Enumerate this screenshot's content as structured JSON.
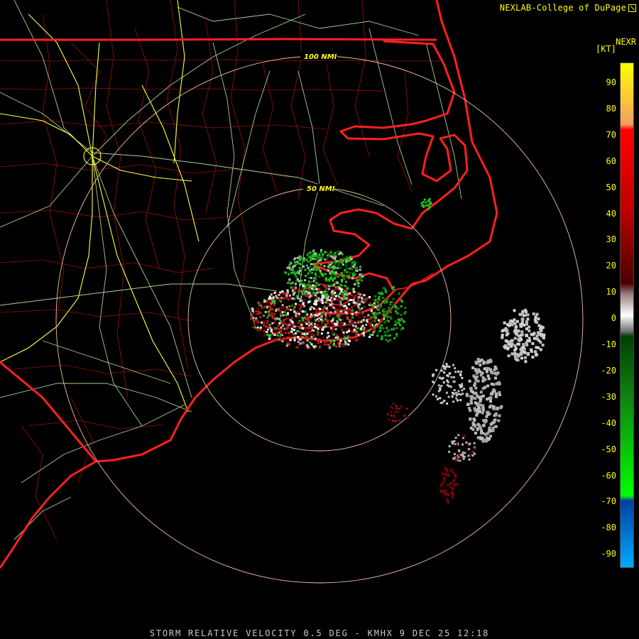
{
  "credit": "NEXLAB-College of DuPage",
  "product_title": "STORM RELATIVE VELOCITY 0.5 DEG - KMHX 9 DEC 25 12:18",
  "scale": {
    "title": "NEXR",
    "unit": "[KT]",
    "ticks": [
      "90",
      "80",
      "70",
      "60",
      "50",
      "40",
      "30",
      "20",
      "10",
      "0",
      "-10",
      "-20",
      "-30",
      "-40",
      "-50",
      "-60",
      "-70",
      "-80",
      "-90"
    ],
    "gradient": [
      {
        "value": 95,
        "color": "#ffff00"
      },
      {
        "value": 72,
        "color": "#f4a060"
      },
      {
        "value": 70,
        "color": "#ff0000"
      },
      {
        "value": 40,
        "color": "#c00000"
      },
      {
        "value": 12,
        "color": "#4a0000"
      },
      {
        "value": 8,
        "color": "#9a8080"
      },
      {
        "value": 0,
        "color": "#ffffff"
      },
      {
        "value": -6,
        "color": "#707070"
      },
      {
        "value": -8,
        "color": "#004000"
      },
      {
        "value": -30,
        "color": "#108010"
      },
      {
        "value": -68,
        "color": "#00ff00"
      },
      {
        "value": -70,
        "color": "#0040a0"
      },
      {
        "value": -95,
        "color": "#00aaff"
      }
    ]
  },
  "range_rings": [
    {
      "label": "50 NMI",
      "nmi": 50
    },
    {
      "label": "100 NMI",
      "nmi": 100
    }
  ],
  "colors": {
    "state_border": "#ff2020",
    "county_border": "#a01010",
    "highway": "#b8e8a0",
    "interstate": "#ffff40",
    "range_ring": "#f0c0a0",
    "inbound_strong": "#20c020",
    "outbound": "#c01818",
    "near_zero": "#bdbdbd",
    "outbound_dark": "#6a0808"
  }
}
